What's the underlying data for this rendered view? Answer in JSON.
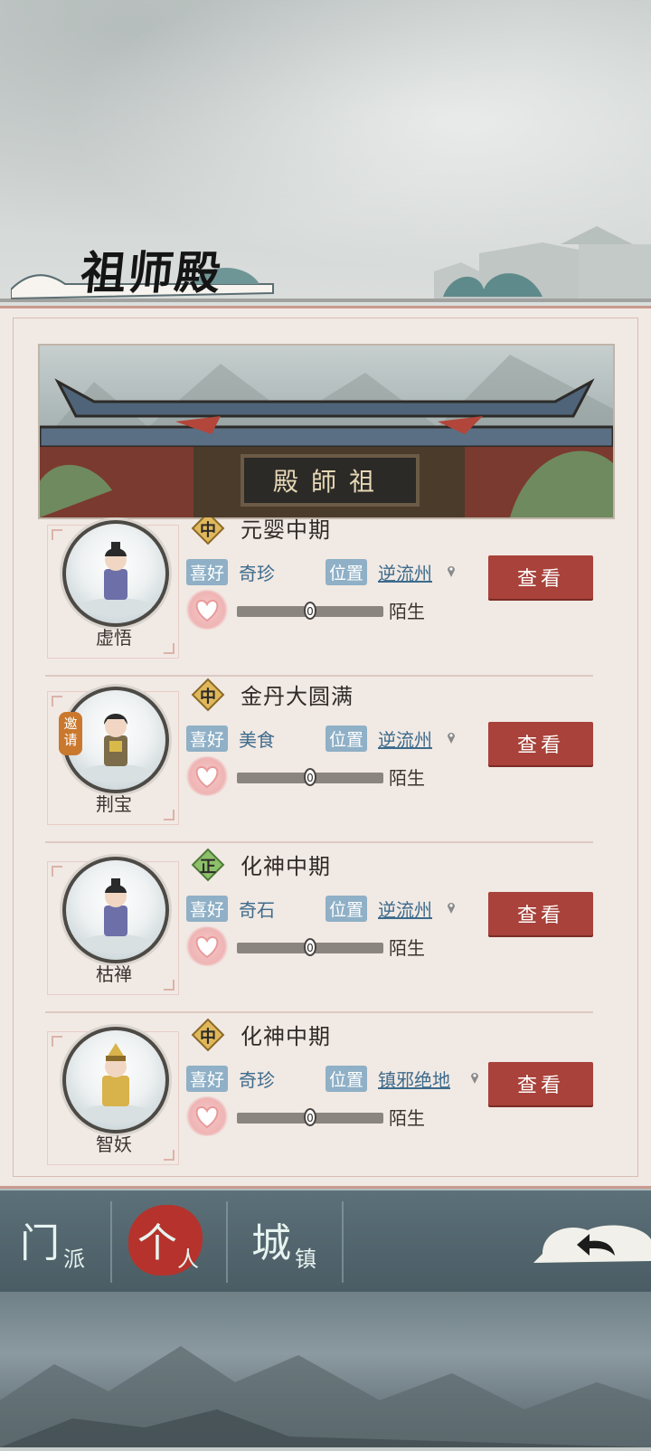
{
  "header": {
    "title": "祖师殿"
  },
  "banner": {
    "plaque_text": "殿師祖"
  },
  "disciples": [
    {
      "name": "虚悟",
      "badge": "中",
      "badge_color": "#e0b85a",
      "realm": "元婴中期",
      "hobby_label": "喜好",
      "hobby": "奇珍",
      "location_label": "位置",
      "location": "逆流州",
      "affinity": "0",
      "relation": "陌生",
      "button": "查看",
      "invite": ""
    },
    {
      "name": "荆宝",
      "badge": "中",
      "badge_color": "#e0b85a",
      "realm": "金丹大圆满",
      "hobby_label": "喜好",
      "hobby": "美食",
      "location_label": "位置",
      "location": "逆流州",
      "affinity": "0",
      "relation": "陌生",
      "button": "查看",
      "invite": "邀请"
    },
    {
      "name": "枯禅",
      "badge": "正",
      "badge_color": "#8cc06a",
      "realm": "化神中期",
      "hobby_label": "喜好",
      "hobby": "奇石",
      "location_label": "位置",
      "location": "逆流州",
      "affinity": "0",
      "relation": "陌生",
      "button": "查看",
      "invite": ""
    },
    {
      "name": "智妖",
      "badge": "中",
      "badge_color": "#e0b85a",
      "realm": "化神中期",
      "hobby_label": "喜好",
      "hobby": "奇珍",
      "location_label": "位置",
      "location": "镇邪绝地",
      "affinity": "0",
      "relation": "陌生",
      "button": "查看",
      "invite": ""
    }
  ],
  "nav": {
    "tabs": [
      {
        "big": "门",
        "small": "派",
        "active": false
      },
      {
        "big": "个",
        "small": "人",
        "active": true
      },
      {
        "big": "城",
        "small": "镇",
        "active": false
      }
    ],
    "back_icon": "back-arrow-icon"
  },
  "colors": {
    "accent_red": "#a8423a",
    "tag_blue": "#8fb0c6",
    "link_blue": "#3d6b8c",
    "panel": "#f1e9e4"
  }
}
